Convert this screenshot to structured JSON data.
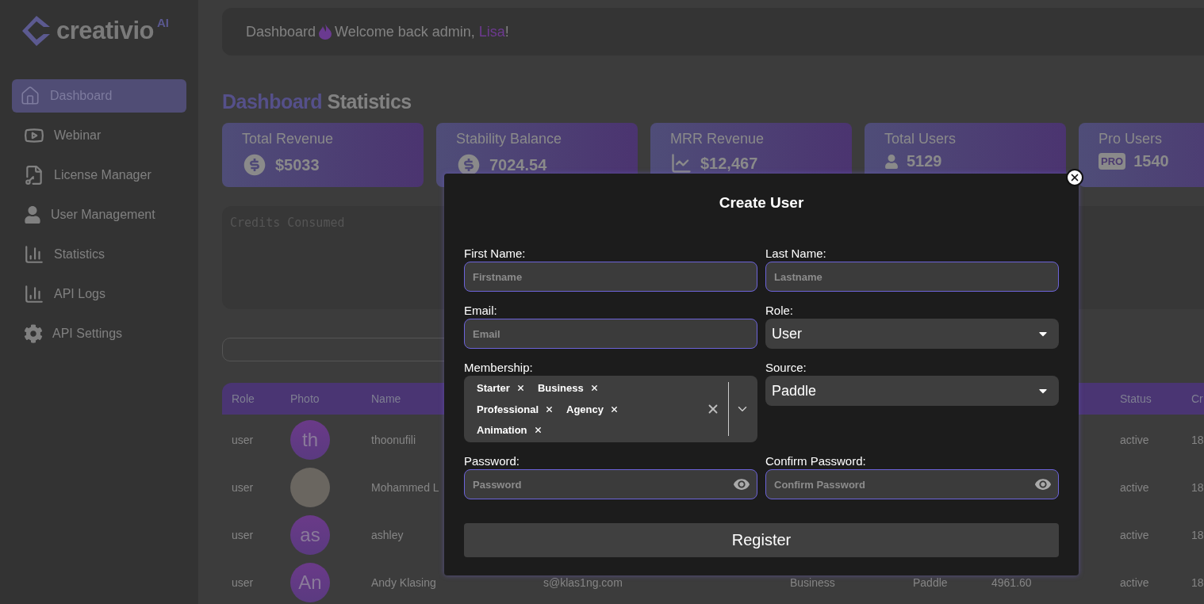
{
  "logo": {
    "name": "creativio",
    "suffix": "AI"
  },
  "sidebar": {
    "items": [
      {
        "label": "Dashboard",
        "selected": true
      },
      {
        "label": "Webinar",
        "selected": false
      },
      {
        "label": "License Manager",
        "selected": false
      },
      {
        "label": "User Management",
        "selected": false
      },
      {
        "label": "Statistics",
        "selected": false
      },
      {
        "label": "API Logs",
        "selected": false
      },
      {
        "label": "API Settings",
        "selected": false
      }
    ]
  },
  "header": {
    "page": "Dashboard",
    "greeting": "Welcome back admin, ",
    "user": "Lisa",
    "greeting_end": "!"
  },
  "title": {
    "accent": "Dashboard",
    "rest": " Statistics"
  },
  "stats": [
    {
      "label": "Total Revenue",
      "value": "$5033",
      "kind": "dollar"
    },
    {
      "label": "Stability Balance",
      "value": "7024.54",
      "kind": "dollar"
    },
    {
      "label": "MRR Revenue",
      "value": "$12,467",
      "kind": "trend"
    },
    {
      "label": "Total Users",
      "value": "5129",
      "kind": "user"
    },
    {
      "label": "Pro Users",
      "value": "1540",
      "kind": "badge",
      "badge": "PRO"
    }
  ],
  "credits_panel": {
    "title": "Credits Consumed"
  },
  "table": {
    "columns": [
      "Role",
      "Photo",
      "Name",
      null,
      null,
      null,
      null,
      "Status",
      "Cr"
    ],
    "rows": [
      {
        "cells": [
          "user",
          {
            "kind": "initials",
            "text": "th"
          },
          "thoonufili",
          null,
          null,
          null,
          null,
          "active",
          "18"
        ]
      },
      {
        "cells": [
          "user",
          {
            "kind": "photo"
          },
          "Mohammed L",
          null,
          null,
          null,
          null,
          "active",
          "18"
        ]
      },
      {
        "cells": [
          "user",
          {
            "kind": "initials",
            "text": "as"
          },
          "ashley",
          null,
          null,
          null,
          null,
          "active",
          "18"
        ]
      },
      {
        "cells": [
          "user",
          {
            "kind": "initials",
            "text": "An"
          },
          "Andy Klasing",
          "s@klas1ng.com",
          "Business",
          "Paddle",
          "4961.60",
          "active",
          "18"
        ]
      }
    ]
  },
  "modal": {
    "title": "Create User",
    "rows": [
      [
        {
          "kind": "text",
          "label": "First Name:",
          "placeholder": "Firstname"
        },
        {
          "kind": "text",
          "label": "Last Name:",
          "placeholder": "Lastname"
        }
      ],
      [
        {
          "kind": "text",
          "label": "Email:",
          "placeholder": "Email"
        },
        {
          "kind": "select",
          "label": "Role:",
          "value": "User"
        }
      ],
      [
        {
          "kind": "multi",
          "label": "Membership:",
          "tags": [
            "Starter",
            "Business",
            "Professional",
            "Agency",
            "Animation"
          ]
        },
        {
          "kind": "select",
          "label": "Source:",
          "value": "Paddle"
        }
      ],
      [
        {
          "kind": "password",
          "label": "Password:",
          "placeholder": "Password"
        },
        {
          "kind": "password",
          "label": "Confirm Password:",
          "placeholder": "Confirm Password"
        }
      ]
    ],
    "submit": "Register"
  }
}
